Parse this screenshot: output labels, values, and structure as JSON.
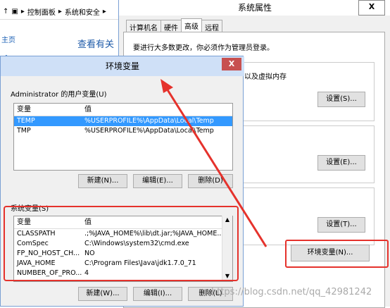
{
  "explorer": {
    "breadcrumb": [
      "控制面板",
      "系统和安全"
    ],
    "side_item": "主页",
    "side_item2": "•",
    "link_text": "查看有关"
  },
  "sysprops": {
    "title": "系统属性",
    "close": "X",
    "tabs": [
      "计算机名",
      "硬件",
      "高级",
      "远程"
    ],
    "active_tab": "高级",
    "admin_note": "要进行大多数更改，你必须作为管理员登录。",
    "perf_text": "以及虚拟内存",
    "settings1": "设置(S)...",
    "settings2": "设置(E)...",
    "settings3": "设置(T)...",
    "env_button": "环境变量(N)..."
  },
  "envdlg": {
    "title": "环境变量",
    "close": "X",
    "user_vars_label": "Administrator 的用户变量(U)",
    "user_header": {
      "name": "变量",
      "value": "值"
    },
    "user_rows": [
      {
        "name": "TEMP",
        "value": "%USERPROFILE%\\AppData\\Local\\Temp",
        "selected": true
      },
      {
        "name": "TMP",
        "value": "%USERPROFILE%\\AppData\\Local\\Temp",
        "selected": false
      }
    ],
    "user_new": "新建(N)...",
    "user_edit": "编辑(E)...",
    "user_delete": "删除(D)",
    "sys_vars_label": "系统变量(S)",
    "sys_header": {
      "name": "变量",
      "value": "值"
    },
    "sys_rows": [
      {
        "name": "CLASSPATH",
        "value": ".;%JAVA_HOME%\\lib\\dt.jar;%JAVA_HOME..."
      },
      {
        "name": "ComSpec",
        "value": "C:\\Windows\\system32\\cmd.exe"
      },
      {
        "name": "FP_NO_HOST_CH...",
        "value": "NO"
      },
      {
        "name": "JAVA_HOME",
        "value": "C:\\Program Files\\Java\\jdk1.7.0_71"
      },
      {
        "name": "NUMBER_OF_PRO...",
        "value": "4"
      }
    ],
    "sys_new": "新建(W)...",
    "sys_edit": "编辑(I)...",
    "sys_delete": "删除(L)"
  },
  "watermark": "https://blog.csdn.net/qq_42981242",
  "colors": {
    "annotation": "#e5322c",
    "selection": "#3399ff"
  }
}
